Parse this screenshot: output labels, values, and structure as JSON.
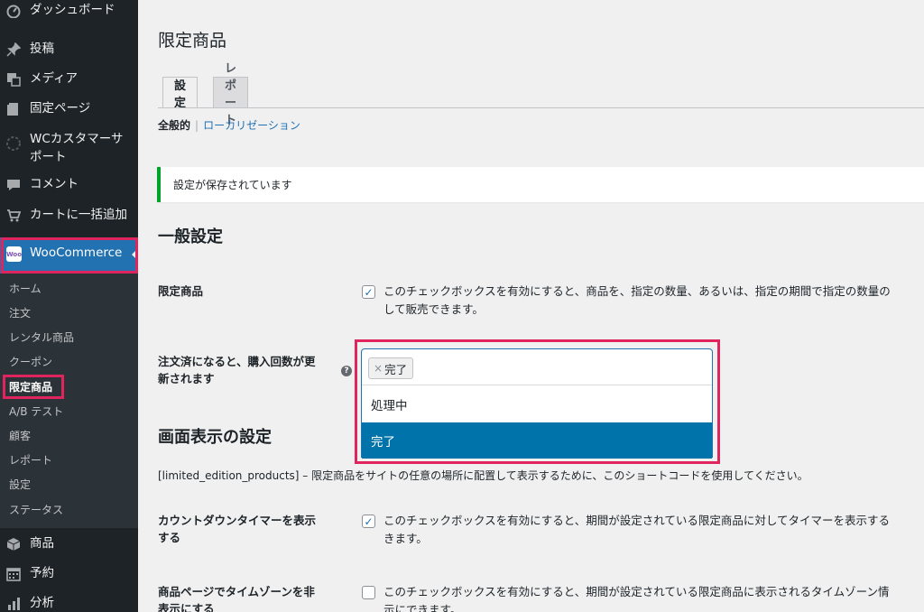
{
  "sidebar": {
    "items": [
      {
        "label": "ダッシュボード",
        "icon": "dashboard-icon"
      },
      {
        "label": "投稿",
        "icon": "pin-icon"
      },
      {
        "label": "メディア",
        "icon": "media-icon"
      },
      {
        "label": "固定ページ",
        "icon": "page-icon"
      },
      {
        "label": "WCカスタマーサポート",
        "icon": "support-icon"
      },
      {
        "label": "コメント",
        "icon": "comment-icon"
      },
      {
        "label": "カートに一括追加",
        "icon": "cart-icon"
      }
    ],
    "woocommerce": {
      "label": "WooCommerce",
      "badge": "Woo"
    },
    "submenu": [
      "ホーム",
      "注文",
      "レンタル商品",
      "クーポン",
      "限定商品",
      "A/B テスト",
      "顧客",
      "レポート",
      "設定",
      "ステータス"
    ],
    "bottom_items": [
      {
        "label": "商品",
        "icon": "product-icon"
      },
      {
        "label": "予約",
        "icon": "calendar-icon"
      },
      {
        "label": "分析",
        "icon": "analytics-icon"
      }
    ]
  },
  "page": {
    "title": "限定商品",
    "tabs": [
      "設定",
      "レポート"
    ],
    "subsub": {
      "current": "全般的",
      "separator": "|",
      "link": "ローカリゼーション"
    },
    "notice": "設定が保存されています",
    "general_heading": "一般設定",
    "display_heading": "画面表示の設定",
    "help_icon": "?",
    "fields": {
      "limited": {
        "label": "限定商品",
        "checked": true,
        "desc_line1": "このチェックボックスを有効にすると、商品を、指定の数量、あるいは、指定の期間で指定の数量の",
        "desc_line2": "して販売できます。"
      },
      "order_status": {
        "label_line1": "注文済になると、購入回数が更",
        "label_line2": "新されます",
        "chip_remove": "×",
        "chip": "完了",
        "options": [
          "処理中",
          "完了"
        ],
        "highlighted": "完了"
      },
      "countdown": {
        "label_line1": "カウントダウンタイマーを表示",
        "label_line2": "する",
        "checked": true,
        "desc_line1": "このチェックボックスを有効にすると、期間が設定されている限定商品に対してタイマーを表示する",
        "desc_line2": "きます。"
      },
      "timezone": {
        "label_line1": "商品ページでタイムゾーンを非",
        "label_line2": "表示にする",
        "checked": false,
        "desc_line1": "このチェックボックスを有効にすると、期間が設定されている限定商品に表示されるタイムゾーン情",
        "desc_line2": "示にできます。"
      }
    },
    "shortcode_text": "[limited_edition_products] – 限定商品をサイトの任意の場所に配置して表示するために、このショートコードを使用してください。"
  },
  "colors": {
    "sidebar_bg": "#1d2327",
    "submenu_bg": "#2c3338",
    "accent": "#2271b1",
    "highlight_option": "#0073aa",
    "annotation": "#e0245e",
    "notice_success": "#00a32a"
  }
}
